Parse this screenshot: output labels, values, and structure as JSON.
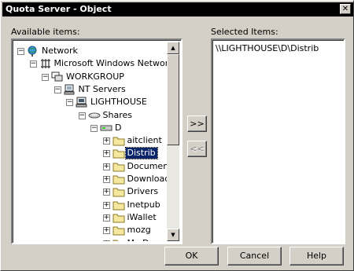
{
  "window": {
    "title": "Quota Server - Object",
    "close_symbol": "✕"
  },
  "available": {
    "label": "Available items:",
    "tree": [
      {
        "label": "Network",
        "icon": "globe-icon",
        "toggle": "−",
        "depth": 0
      },
      {
        "label": "Microsoft Windows Network",
        "icon": "network-icon",
        "toggle": "−",
        "depth": 1
      },
      {
        "label": "WORKGROUP",
        "icon": "workgroup-icon",
        "toggle": "−",
        "depth": 2
      },
      {
        "label": "NT Servers",
        "icon": "servers-icon",
        "toggle": "−",
        "depth": 3
      },
      {
        "label": "LIGHTHOUSE",
        "icon": "computer-icon",
        "toggle": "−",
        "depth": 4
      },
      {
        "label": "Shares",
        "icon": "shares-icon",
        "toggle": "−",
        "depth": 5
      },
      {
        "label": "D",
        "icon": "drive-icon",
        "toggle": "−",
        "depth": 6
      },
      {
        "label": "aitclient",
        "icon": "folder-icon",
        "toggle": "+",
        "depth": 7
      },
      {
        "label": "Distrib",
        "icon": "folder-icon",
        "toggle": "+",
        "depth": 7,
        "selected": true
      },
      {
        "label": "Documents ar",
        "icon": "folder-icon",
        "toggle": "+",
        "depth": 7
      },
      {
        "label": "Downloads",
        "icon": "folder-icon",
        "toggle": "+",
        "depth": 7
      },
      {
        "label": "Drivers",
        "icon": "folder-icon",
        "toggle": "+",
        "depth": 7
      },
      {
        "label": "Inetpub",
        "icon": "folder-icon",
        "toggle": "+",
        "depth": 7
      },
      {
        "label": "iWallet",
        "icon": "folder-icon",
        "toggle": "+",
        "depth": 7
      },
      {
        "label": "mozg",
        "icon": "folder-icon",
        "toggle": "+",
        "depth": 7
      },
      {
        "label": "My Download",
        "icon": "folder-icon",
        "toggle": "+",
        "depth": 7
      }
    ]
  },
  "selected": {
    "label": "Selected Items:",
    "items": [
      "\\\\LIGHTHOUSE\\D\\Distrib"
    ]
  },
  "buttons": {
    "add": ">>",
    "remove": "<<",
    "ok": "OK",
    "cancel": "Cancel",
    "help": "Help"
  },
  "scroll": {
    "up": "▲",
    "down": "▼"
  }
}
